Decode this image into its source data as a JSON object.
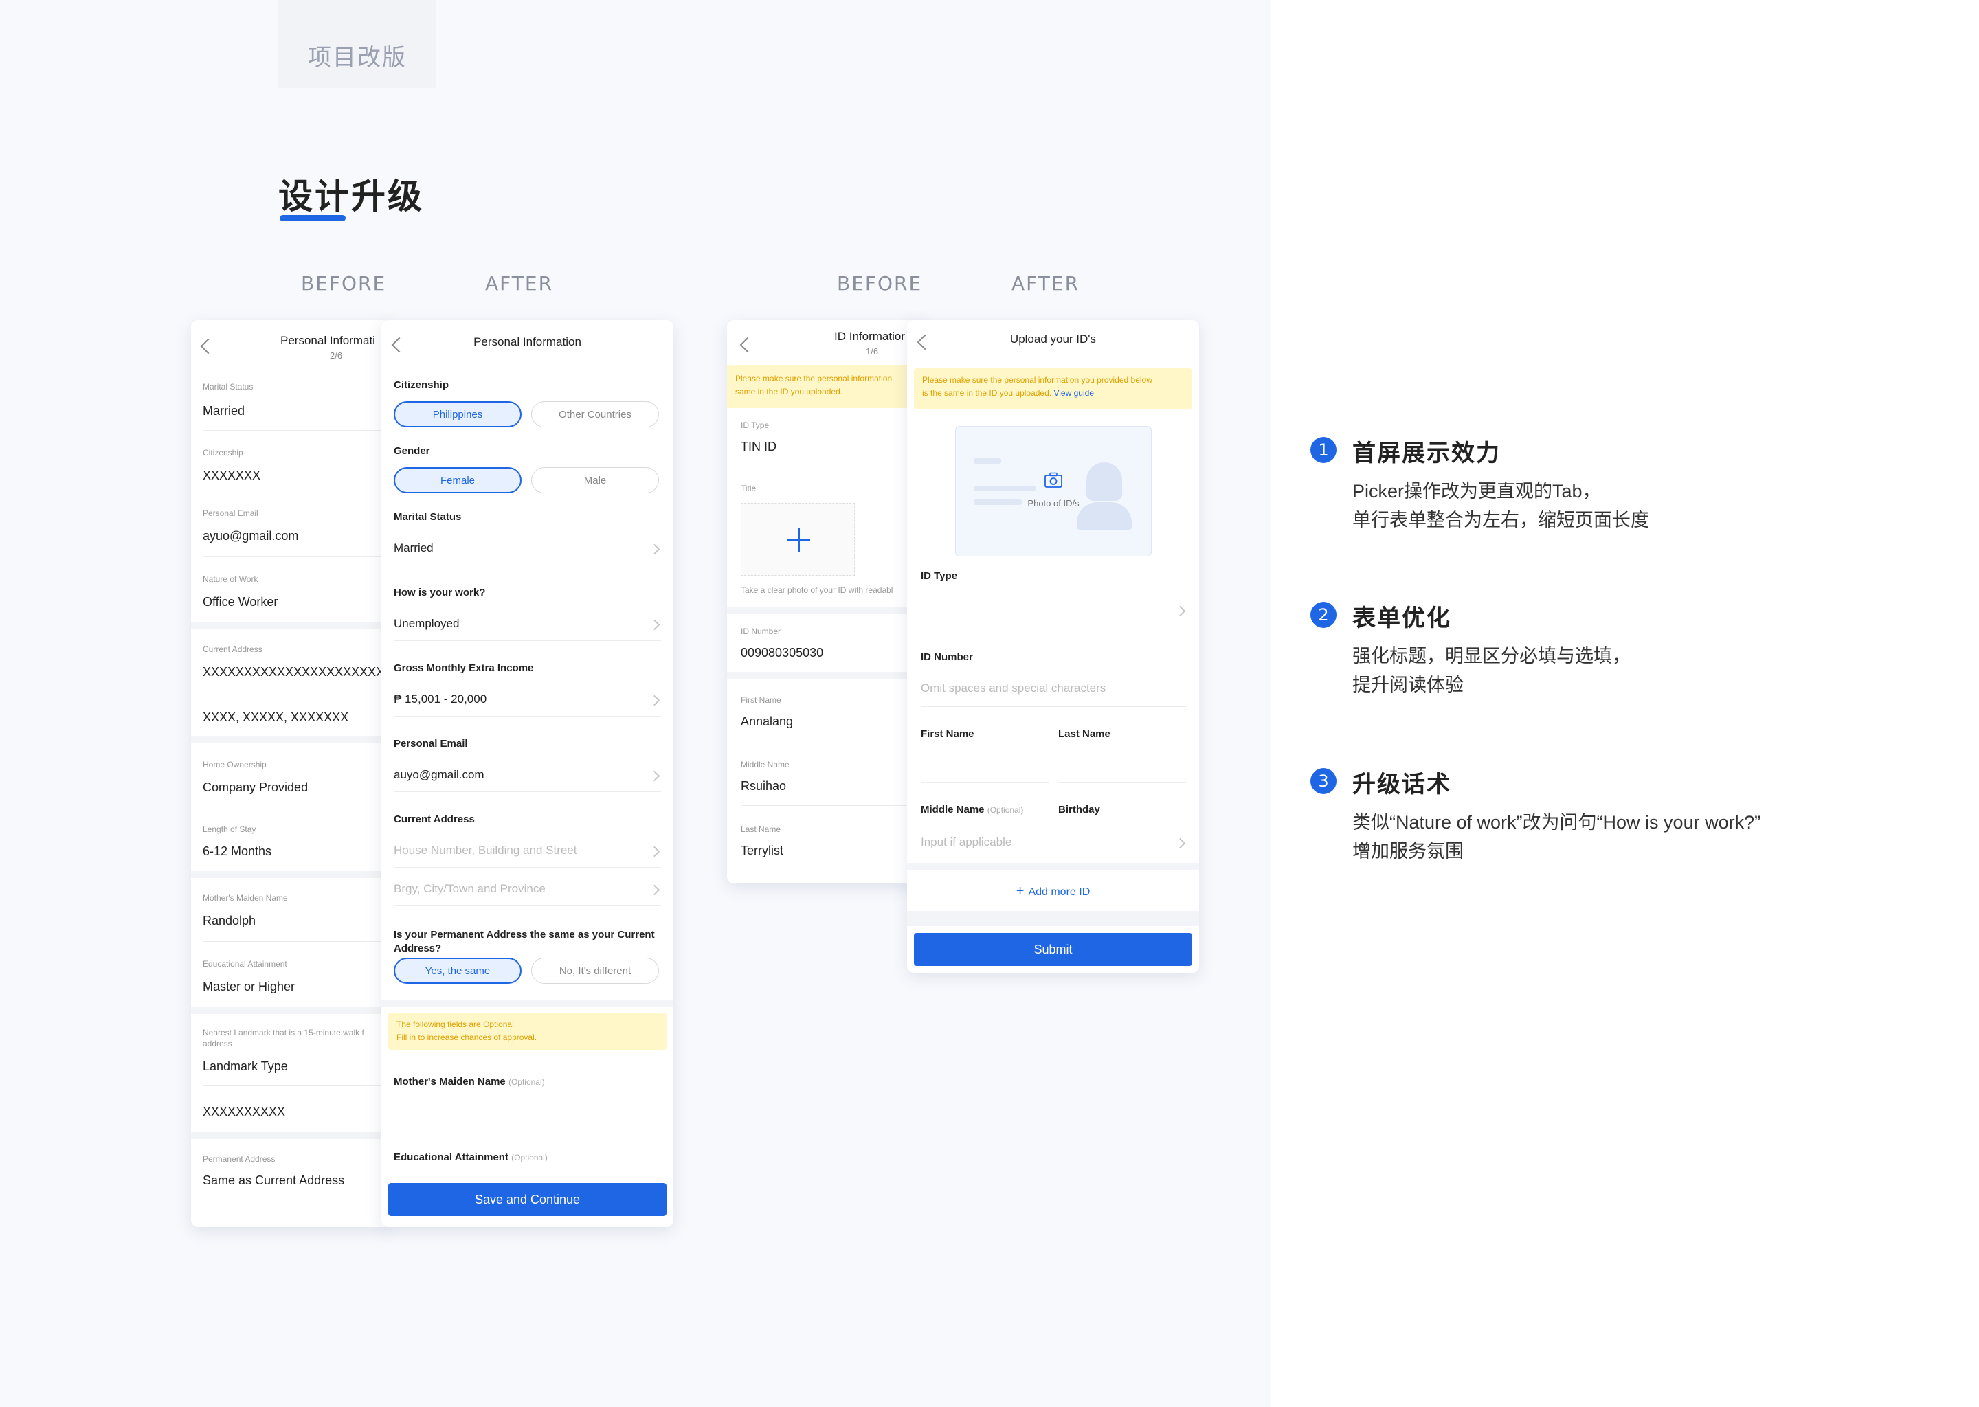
{
  "tag": "项目改版",
  "section_title": "设计升级",
  "labels": {
    "before": "BEFORE",
    "after": "AFTER"
  },
  "personal_before": {
    "title": "Personal Informati",
    "step": "2/6",
    "fields": [
      {
        "label": "Marital Status",
        "value": "Married"
      },
      {
        "label": "Citizenship",
        "value": "XXXXXXX"
      },
      {
        "label": "Personal Email",
        "value": "ayuo@gmail.com"
      },
      {
        "label": "Nature of Work",
        "value": "Office Worker"
      },
      {
        "label": "Current Address",
        "value": "XXXXXXXXXXXXXXXXXXXXXX"
      },
      {
        "label": "",
        "value": "XXXX, XXXXX, XXXXXXX"
      },
      {
        "label": "Home Ownership",
        "value": "Company Provided"
      },
      {
        "label": "Length of Stay",
        "value": "6-12 Months"
      },
      {
        "label": "Mother's Maiden Name",
        "value": "Randolph"
      },
      {
        "label": "Educational Attainment",
        "value": "Master or Higher"
      },
      {
        "label": "Nearest Landmark that is a 15-minute walk f",
        "label2": "address",
        "value": "Landmark Type"
      },
      {
        "label": "",
        "value": "XXXXXXXXXX"
      },
      {
        "label": "Permanent Address",
        "value": "Same as Current Address"
      }
    ]
  },
  "personal_after": {
    "title": "Personal Information",
    "citizenship": {
      "label": "Citizenship",
      "options": [
        "Philippines",
        "Other Countries"
      ]
    },
    "gender": {
      "label": "Gender",
      "options": [
        "Female",
        "Male"
      ]
    },
    "marital": {
      "label": "Marital Status",
      "value": "Married"
    },
    "work": {
      "label": "How is your work?",
      "value": "Unemployed"
    },
    "income": {
      "label": "Gross Monthly Extra Income",
      "value": "₱ 15,001 - 20,000"
    },
    "email": {
      "label": "Personal Email",
      "value": "auyo@gmail.com"
    },
    "address": {
      "label": "Current Address",
      "ph1": "House Number, Building and Street",
      "ph2": "Brgy, City/Town and Province"
    },
    "permanent": {
      "label1": "Is your Permanent Address the same as your Current",
      "label2": "Address?",
      "options": [
        "Yes, the same",
        "No, It's different"
      ]
    },
    "notice": {
      "line1": "The following fields are Optional.",
      "line2": "Fill in to increase chances of approval."
    },
    "maiden": {
      "label": "Mother's Maiden Name",
      "optional": "(Optional)"
    },
    "education": {
      "label": "Educational Attainment",
      "optional": "(Optional)"
    },
    "button": "Save and Continue"
  },
  "id_before": {
    "title": "ID Informatior",
    "step": "1/6",
    "notice": {
      "line1": "Please make sure the personal information",
      "line2": "same in the ID you uploaded."
    },
    "id_type": {
      "label": "ID Type",
      "value": "TIN ID"
    },
    "title_label": "Title",
    "photo_hint": "Take a clear photo of your ID with readabl",
    "id_number": {
      "label": "ID Number",
      "value": "009080305030"
    },
    "first": {
      "label": "First Name",
      "value": "Annalang"
    },
    "middle": {
      "label": "Middle Name",
      "value": "Rsuihao"
    },
    "last": {
      "label": "Last Name",
      "value": "Terrylist"
    }
  },
  "id_after": {
    "title": "Upload your ID's",
    "notice": {
      "line1": "Please make sure the personal information you provided below",
      "line2": "is the same in the ID you uploaded.",
      "link": "View guide"
    },
    "photo_label": "Photo of ID/s",
    "id_type": "ID Type",
    "id_number": {
      "label": "ID Number",
      "placeholder": "Omit spaces and special characters"
    },
    "first_name": "First Name",
    "last_name": "Last Name",
    "middle_name": {
      "label": "Middle Name",
      "optional": "(Optional)",
      "placeholder": "Input if applicable"
    },
    "birthday": "Birthday",
    "add_more": "Add more ID",
    "button": "Submit"
  },
  "bullets": [
    {
      "num": "1",
      "title": "首屏展示效力",
      "lines": [
        "Picker操作改为更直观的Tab，",
        "单行表单整合为左右，缩短页面长度"
      ]
    },
    {
      "num": "2",
      "title": "表单优化",
      "lines": [
        "强化标题，明显区分必填与选填，",
        "提升阅读体验"
      ]
    },
    {
      "num": "3",
      "title": "升级话术",
      "lines": [
        "类似“Nature of work”改为问句“How is your work?”",
        "增加服务氛围"
      ]
    }
  ],
  "colors": {
    "accent": "#1f66e5",
    "notice_bg": "#fff7c7",
    "notice_text": "#e0a100"
  }
}
